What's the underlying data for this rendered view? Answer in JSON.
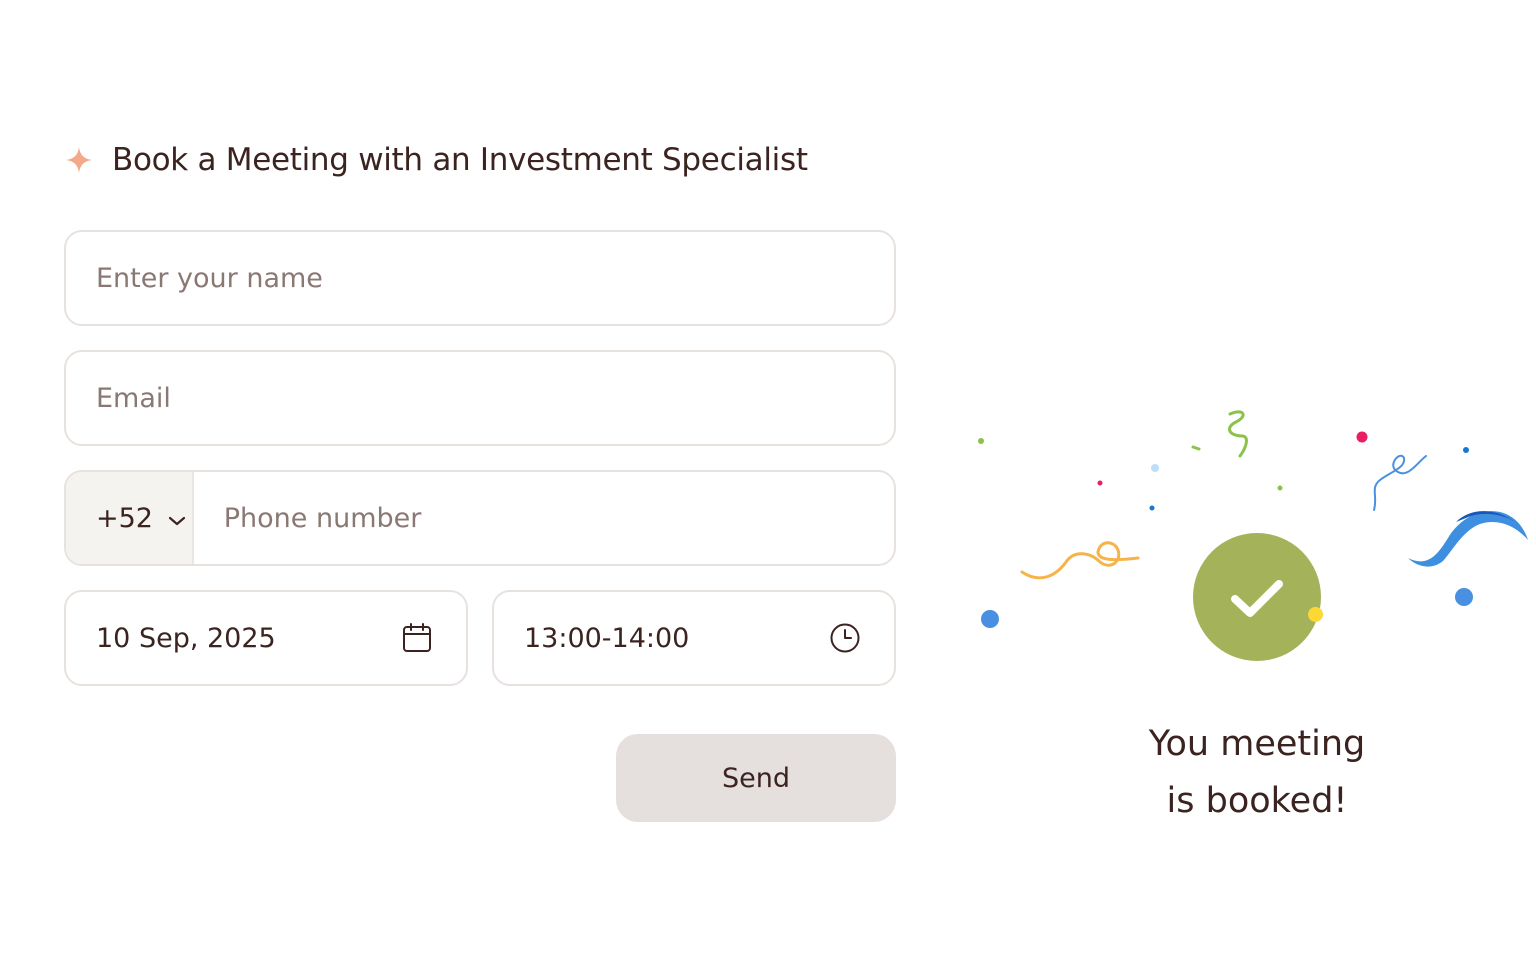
{
  "header": {
    "title": "Book a Meeting with an Investment Specialist",
    "icon": "sparkle-icon",
    "icon_color": "#f4a98a"
  },
  "form": {
    "name": {
      "placeholder": "Enter your name",
      "value": ""
    },
    "email": {
      "placeholder": "Email",
      "value": ""
    },
    "phone": {
      "country_code": "+52",
      "placeholder": "Phone number",
      "value": "",
      "dropdown_icon": "chevron-down-icon"
    },
    "date": {
      "value": "10 Sep, 2025",
      "icon": "calendar-icon"
    },
    "time": {
      "value": "13:00-14:00",
      "icon": "clock-icon"
    },
    "send_label": "Send"
  },
  "confirmation": {
    "line1": "You meeting",
    "line2": "is booked!",
    "icon": "checkmark-icon",
    "badge_color": "#a4b25a"
  },
  "colors": {
    "text": "#3b2320",
    "placeholder": "#8a7874",
    "border": "#e8e2df",
    "button_bg": "#e5dfdd",
    "country_bg": "#f5f3f0"
  }
}
